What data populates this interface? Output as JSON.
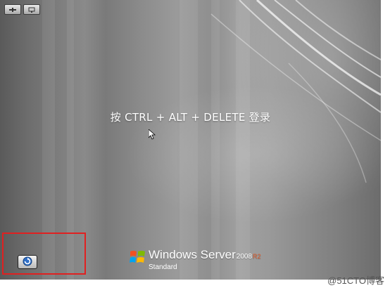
{
  "login": {
    "prompt": "按 CTRL + ALT + DELETE 登录"
  },
  "toolbar": {
    "icons": [
      "pin-icon",
      "monitor-icon"
    ]
  },
  "ease_of_access": {
    "icon": "ease-of-access-icon"
  },
  "branding": {
    "product": "Windows Server",
    "version": "2008",
    "release": "R2",
    "edition": "Standard",
    "logo": "windows-flag-logo"
  },
  "watermark": "@51CTO博客",
  "colors": {
    "highlight_border": "#e02020",
    "r2_accent": "#e05a28",
    "text": "#ffffff"
  }
}
